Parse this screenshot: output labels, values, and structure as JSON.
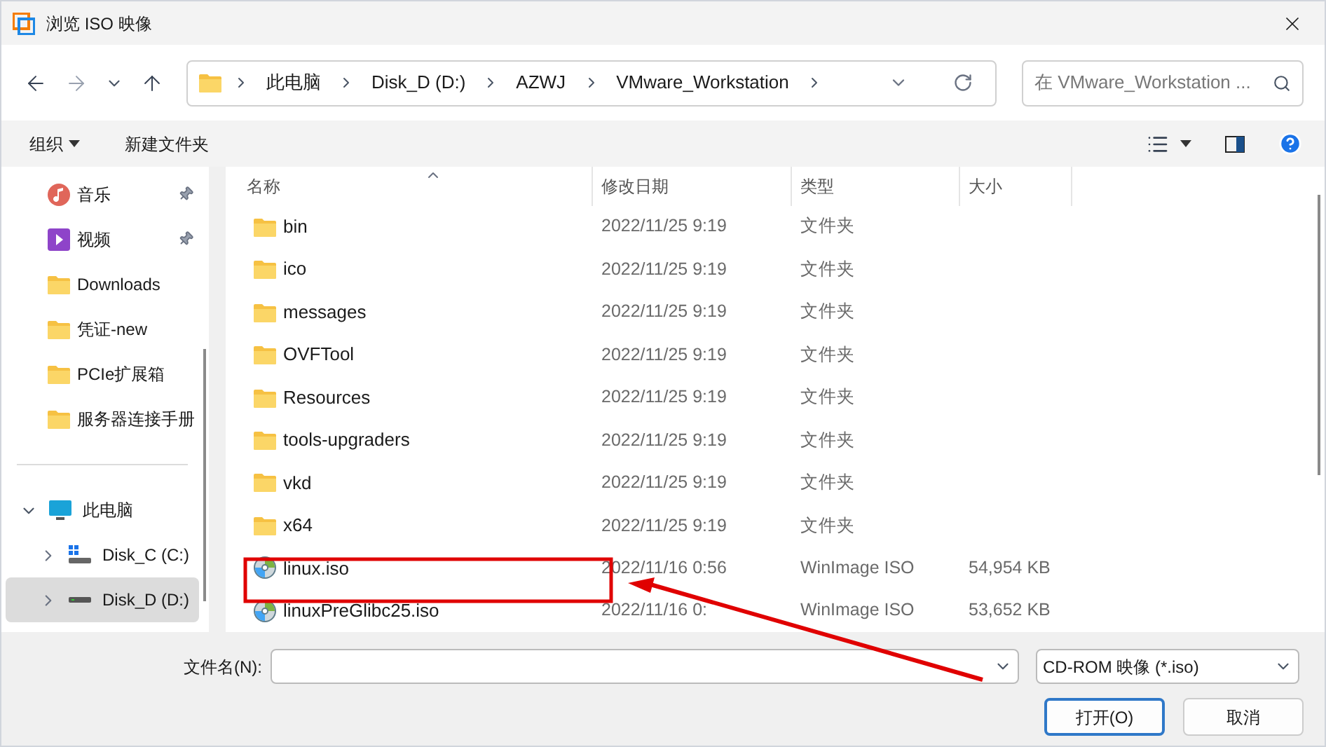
{
  "window": {
    "title": "浏览 ISO 映像"
  },
  "address": {
    "crumbs": [
      "此电脑",
      "Disk_D (D:)",
      "AZWJ",
      "VMware_Workstation"
    ],
    "search_placeholder": "在 VMware_Workstation ..."
  },
  "toolbar": {
    "organize": "组织",
    "new_folder": "新建文件夹"
  },
  "sidebar": {
    "quick": [
      {
        "kind": "music",
        "label": "音乐",
        "pinned": true
      },
      {
        "kind": "video",
        "label": "视频",
        "pinned": true
      },
      {
        "kind": "folder",
        "label": "Downloads",
        "pinned": false
      },
      {
        "kind": "folder",
        "label": "凭证-new",
        "pinned": false
      },
      {
        "kind": "folder",
        "label": "PCIe扩展箱",
        "pinned": false
      },
      {
        "kind": "folder",
        "label": "服务器连接手册",
        "pinned": false
      }
    ],
    "tree": [
      {
        "kind": "pc",
        "label": "此电脑",
        "expanded": true,
        "selected": false,
        "children": [
          {
            "kind": "drive-c",
            "label": "Disk_C (C:)",
            "expanded": false,
            "selected": false
          },
          {
            "kind": "drive",
            "label": "Disk_D (D:)",
            "expanded": false,
            "selected": true
          }
        ]
      }
    ]
  },
  "table": {
    "columns": [
      "名称",
      "修改日期",
      "类型",
      "大小"
    ],
    "rows": [
      {
        "kind": "folder",
        "name": "bin",
        "date": "2022/11/25 9:19",
        "type": "文件夹"
      },
      {
        "kind": "folder",
        "name": "ico",
        "date": "2022/11/25 9:19",
        "type": "文件夹"
      },
      {
        "kind": "folder",
        "name": "messages",
        "date": "2022/11/25 9:19",
        "type": "文件夹"
      },
      {
        "kind": "folder",
        "name": "OVFTool",
        "date": "2022/11/25 9:19",
        "type": "文件夹"
      },
      {
        "kind": "folder",
        "name": "Resources",
        "date": "2022/11/25 9:19",
        "type": "文件夹"
      },
      {
        "kind": "folder",
        "name": "tools-upgraders",
        "date": "2022/11/25 9:19",
        "type": "文件夹"
      },
      {
        "kind": "folder",
        "name": "vkd",
        "date": "2022/11/25 9:19",
        "type": "文件夹"
      },
      {
        "kind": "folder",
        "name": "x64",
        "date": "2022/11/25 9:19",
        "type": "文件夹"
      },
      {
        "kind": "disc",
        "name": "linux.iso",
        "date": "2022/11/16 0:56",
        "type": "WinImage ISO",
        "size": "54,954 KB"
      },
      {
        "kind": "disc",
        "name": "linuxPreGlibc25.iso",
        "date": "2022/11/16 0:",
        "type": "WinImage ISO",
        "size": "53,652 KB"
      }
    ]
  },
  "footer": {
    "filename_label": "文件名(N):",
    "filetype": "CD-ROM 映像 (*.iso)",
    "open": "打开(O)",
    "cancel": "取消"
  }
}
